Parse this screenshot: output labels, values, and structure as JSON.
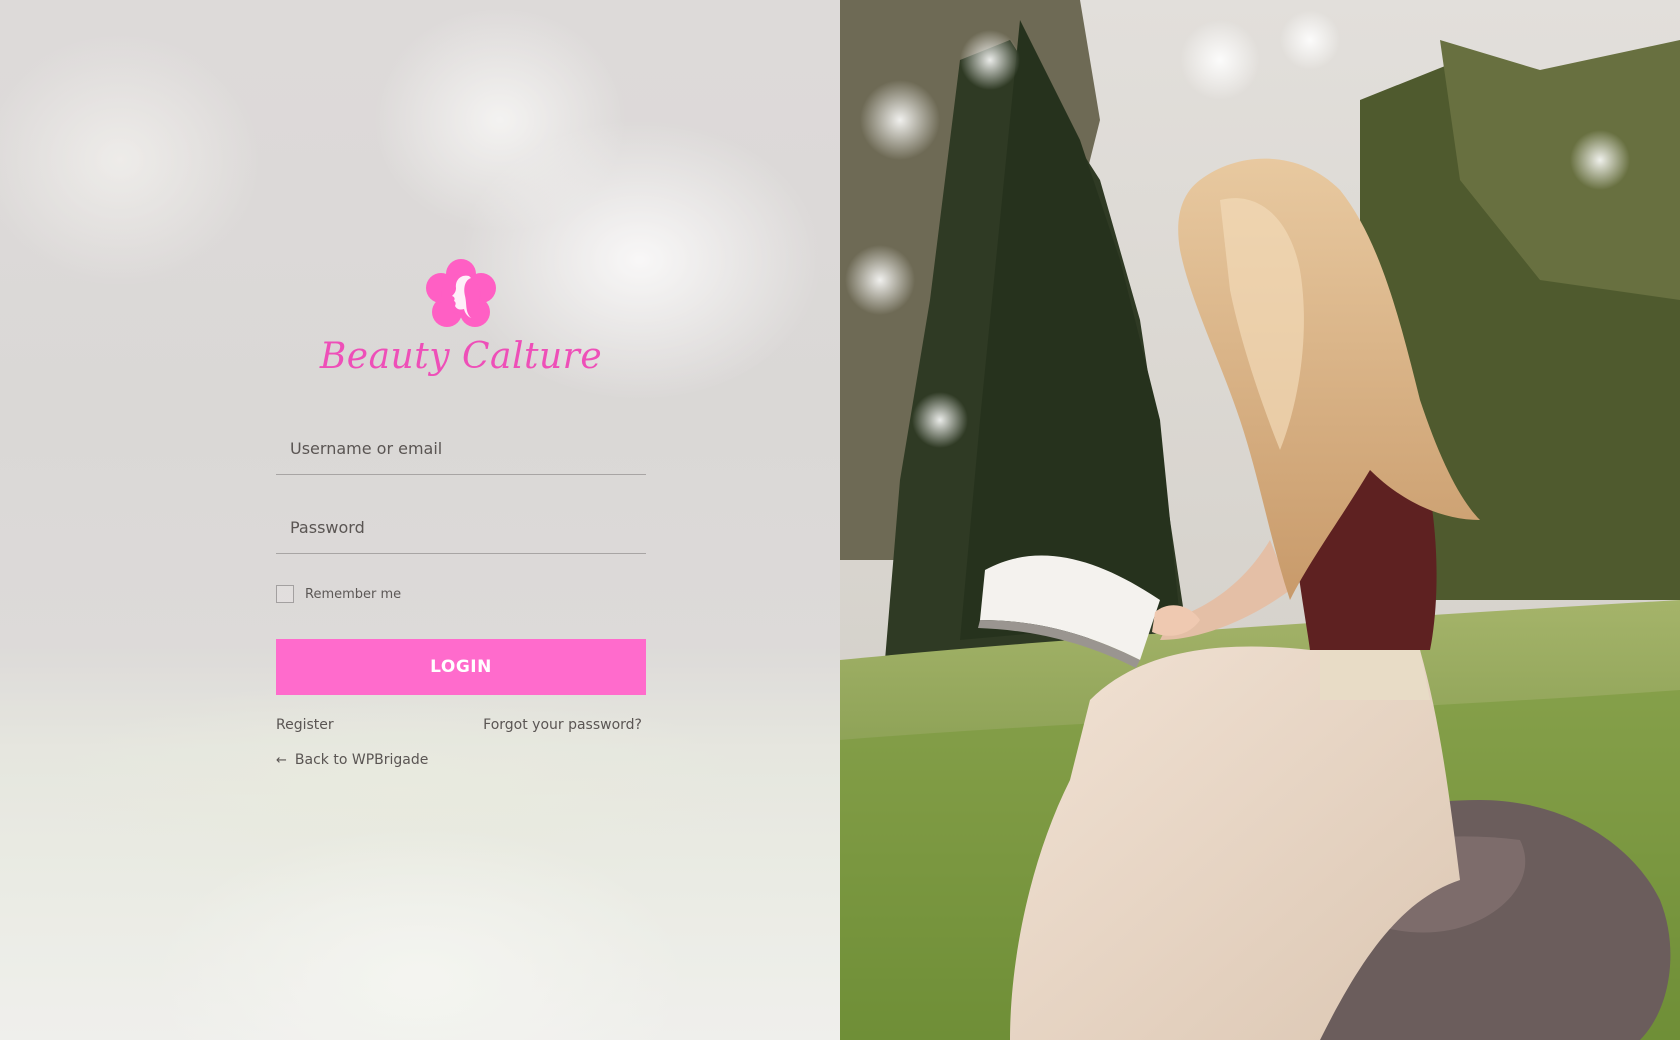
{
  "brand": {
    "name": "Beauty Calture",
    "logo_icon": "flower-woman-face-icon",
    "color": "#ee4fb8"
  },
  "form": {
    "username_placeholder": "Username or email",
    "password_placeholder": "Password",
    "remember_label": "Remember me",
    "remember_checked": false,
    "login_label": "LOGIN",
    "login_color": "#ff6bcc"
  },
  "links": {
    "register": "Register",
    "forgot_password": "Forgot your password?",
    "back_arrow": "←",
    "back": "Back to WPBrigade"
  }
}
